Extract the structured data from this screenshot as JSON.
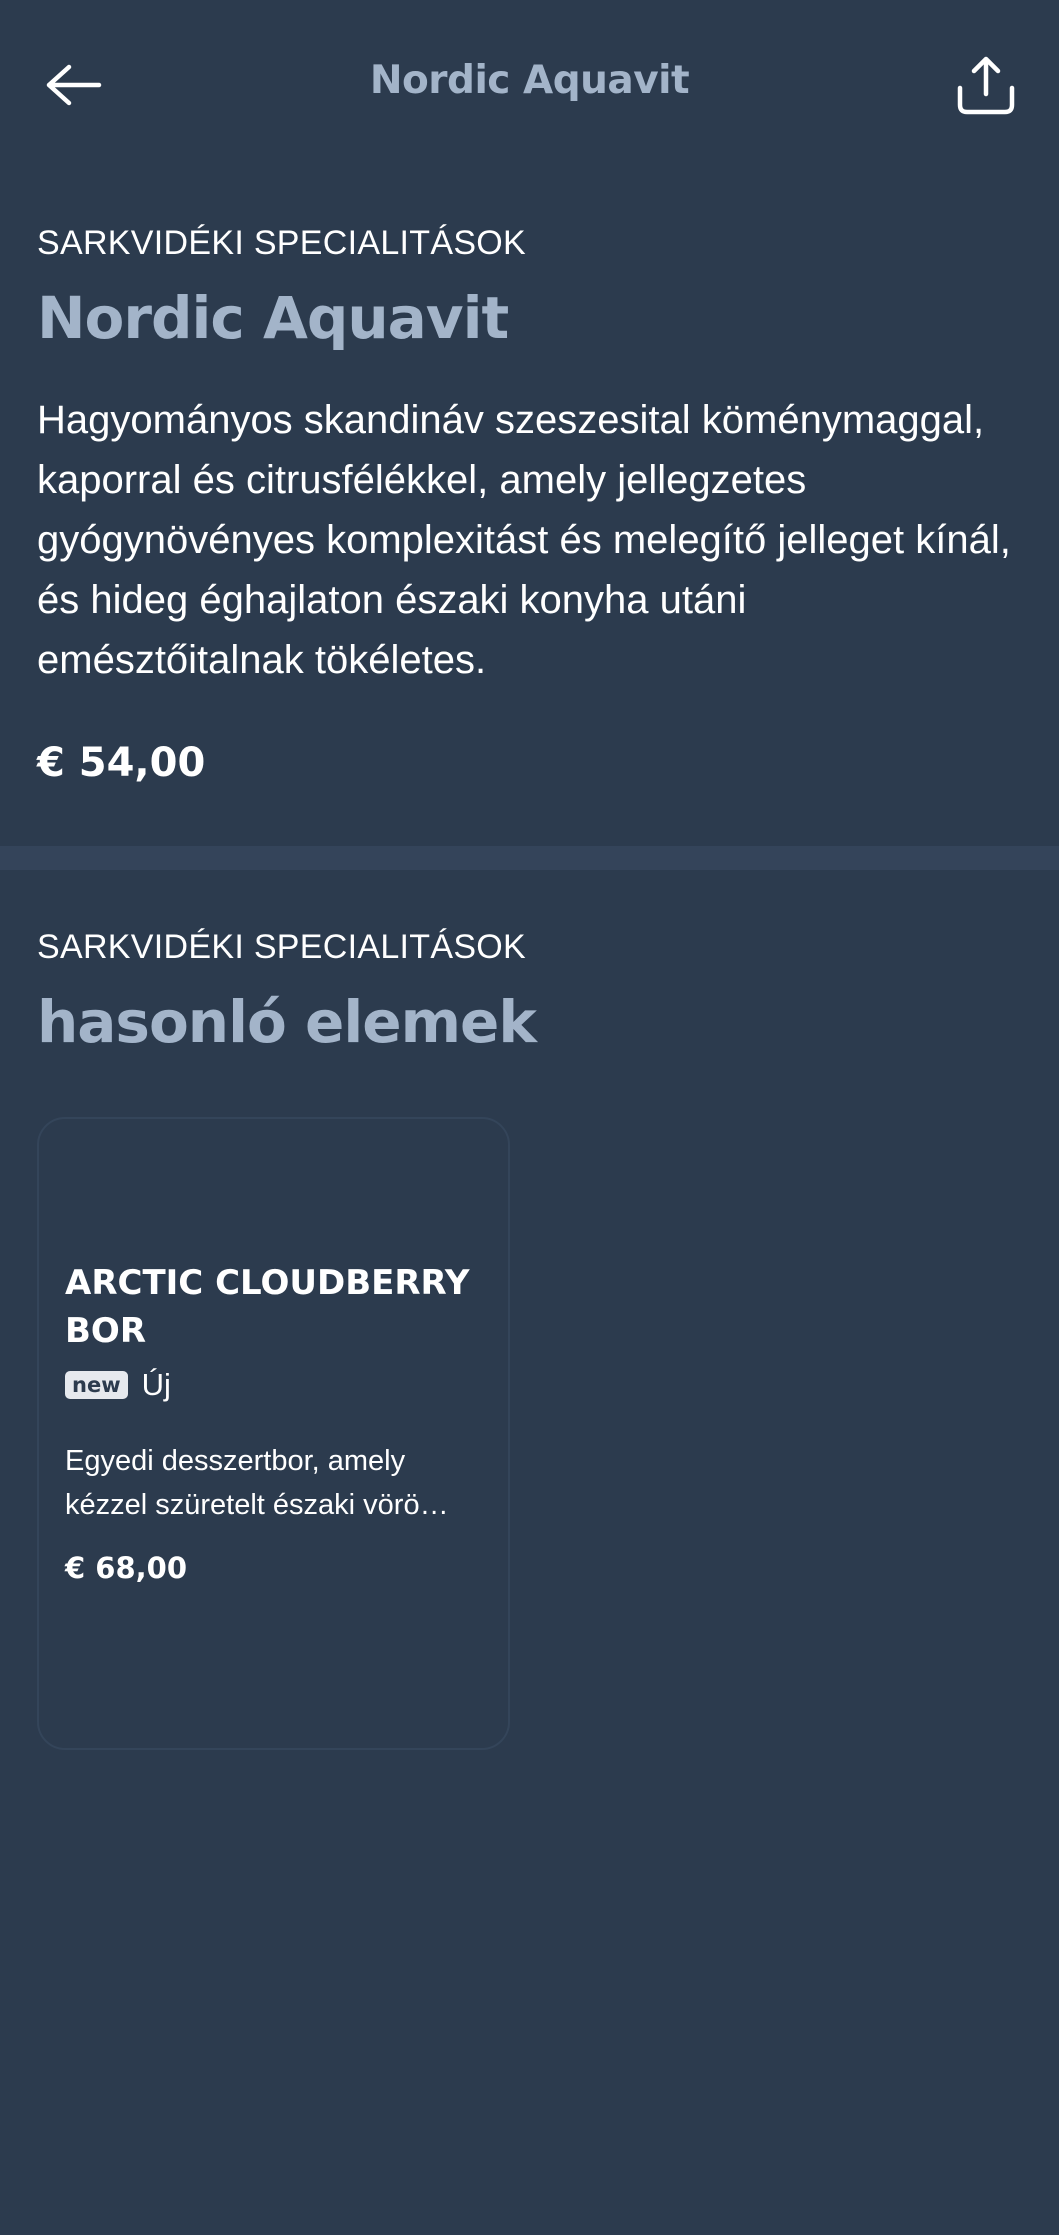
{
  "header": {
    "title": "Nordic Aquavit",
    "back_icon": "arrow-left-icon",
    "share_icon": "share-icon"
  },
  "product": {
    "category": "SARKVIDÉKI SPECIALITÁSOK",
    "name": "Nordic Aquavit",
    "description": "Hagyományos skandináv szeszesital köménymaggal, kaporral és citrusfélékkel, amely jellegzetes gyógynövényes komplexitást és melegítő jelleget kínál, és hideg éghajlaton északi konyha utáni emésztőitalnak tökéletes.",
    "price": "€ 54,00"
  },
  "similar": {
    "category": "SARKVIDÉKI SPECIALITÁSOK",
    "title": "hasonló elemek",
    "items": [
      {
        "name": "ARCTIC CLOUDBERRY BOR",
        "badge": "new",
        "badge_label": "Új",
        "description": "Egyedi desszertbor, amely kézzel szüretelt északi vörö…",
        "price": "€ 68,00"
      }
    ]
  },
  "colors": {
    "background": "#2c3b4e",
    "title_accent": "#a3b4c9",
    "divider": "#34445a",
    "badge_bg": "#e6e9ee"
  }
}
